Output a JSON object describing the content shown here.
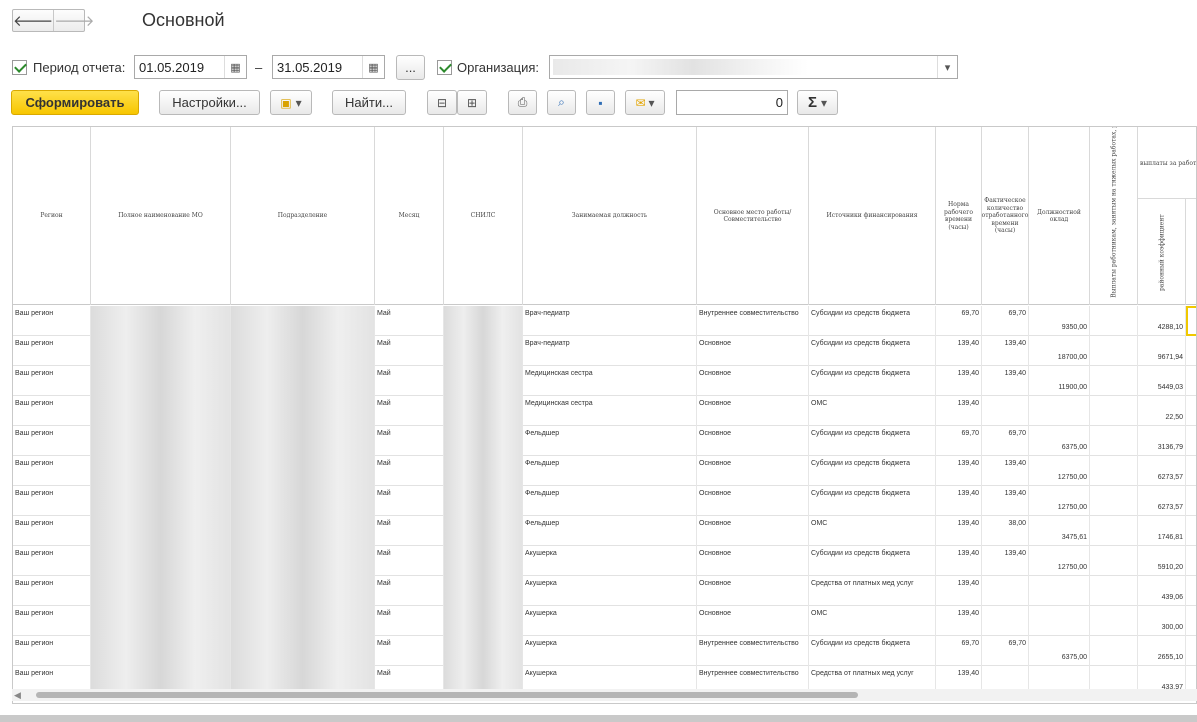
{
  "window": {
    "title": "Основной",
    "back": "🡐",
    "forward": "🡒"
  },
  "filters": {
    "period_label": "Период отчета:",
    "date_from": "01.05.2019",
    "dash": "–",
    "date_to": "31.05.2019",
    "more": "...",
    "org_label": "Организация:",
    "calendar_icon": "▦",
    "dropdown_icon": "▾"
  },
  "toolbar": {
    "generate": "Сформировать",
    "settings": "Настройки...",
    "find": "Найти...",
    "counter_value": "0",
    "sum_icon": "Σ",
    "caret": "▾"
  },
  "table": {
    "headers": [
      "Регион",
      "Полное наименование МО",
      "Подразделение",
      "Месяц",
      "СНИЛС",
      "Занимаемая должность",
      "Основное место работы/Совместительство",
      "Источники финансирования",
      "Норма рабочего времени (часы)",
      "Фактическое количество отработанного времени (часы)",
      "Должностной оклад"
    ],
    "vertical_headers": {
      "hazard": "Выплаты работникам, занятым на тяжелых работах, работах с вредными и (или) опасными и иными особыми условиями труда",
      "regional": "районный коэффициент"
    },
    "group_header": "выплаты за работу",
    "rows": [
      {
        "region": "Ваш регион",
        "month": "Май",
        "position": "Врач-педиатр",
        "place": "Внутреннее совместительство",
        "source": "Субсидии из средств бюджета",
        "norm": "69,70",
        "fact": "69,70",
        "salary": "9350,00",
        "coef": "4288,10"
      },
      {
        "region": "Ваш регион",
        "month": "Май",
        "position": "Врач-педиатр",
        "place": "Основное",
        "source": "Субсидии из средств бюджета",
        "norm": "139,40",
        "fact": "139,40",
        "salary": "18700,00",
        "coef": "9671,94"
      },
      {
        "region": "Ваш регион",
        "month": "Май",
        "position": "Медицинская сестра",
        "place": "Основное",
        "source": "Субсидии из средств бюджета",
        "norm": "139,40",
        "fact": "139,40",
        "salary": "11900,00",
        "coef": "5449,03"
      },
      {
        "region": "Ваш регион",
        "month": "Май",
        "position": "Медицинская сестра",
        "place": "Основное",
        "source": "ОМС",
        "norm": "139,40",
        "fact": "",
        "salary": "",
        "coef": "22,50"
      },
      {
        "region": "Ваш регион",
        "month": "Май",
        "position": "Фельдшер",
        "place": "Основное",
        "source": "Субсидии из средств бюджета",
        "norm": "69,70",
        "fact": "69,70",
        "salary": "6375,00",
        "coef": "3136,79"
      },
      {
        "region": "Ваш регион",
        "month": "Май",
        "position": "Фельдшер",
        "place": "Основное",
        "source": "Субсидии из средств бюджета",
        "norm": "139,40",
        "fact": "139,40",
        "salary": "12750,00",
        "coef": "6273,57"
      },
      {
        "region": "Ваш регион",
        "month": "Май",
        "position": "Фельдшер",
        "place": "Основное",
        "source": "Субсидии из средств бюджета",
        "norm": "139,40",
        "fact": "139,40",
        "salary": "12750,00",
        "coef": "6273,57"
      },
      {
        "region": "Ваш регион",
        "month": "Май",
        "position": "Фельдшер",
        "place": "Основное",
        "source": "ОМС",
        "norm": "139,40",
        "fact": "38,00",
        "salary": "3475,61",
        "coef": "1746,81"
      },
      {
        "region": "Ваш регион",
        "month": "Май",
        "position": "Акушерка",
        "place": "Основное",
        "source": "Субсидии из средств бюджета",
        "norm": "139,40",
        "fact": "139,40",
        "salary": "12750,00",
        "coef": "5910,20"
      },
      {
        "region": "Ваш регион",
        "month": "Май",
        "position": "Акушерка",
        "place": "Основное",
        "source": "Средства от платных мед услуг",
        "norm": "139,40",
        "fact": "",
        "salary": "",
        "coef": "439,06"
      },
      {
        "region": "Ваш регион",
        "month": "Май",
        "position": "Акушерка",
        "place": "Основное",
        "source": "ОМС",
        "norm": "139,40",
        "fact": "",
        "salary": "",
        "coef": "300,00"
      },
      {
        "region": "Ваш регион",
        "month": "Май",
        "position": "Акушерка",
        "place": "Внутреннее совместительство",
        "source": "Субсидии из средств бюджета",
        "norm": "69,70",
        "fact": "69,70",
        "salary": "6375,00",
        "coef": "2655,10"
      },
      {
        "region": "Ваш регион",
        "month": "Май",
        "position": "Акушерка",
        "place": "Внутреннее совместительство",
        "source": "Средства от платных мед услуг",
        "norm": "139,40",
        "fact": "",
        "salary": "",
        "coef": "433,97"
      }
    ]
  }
}
